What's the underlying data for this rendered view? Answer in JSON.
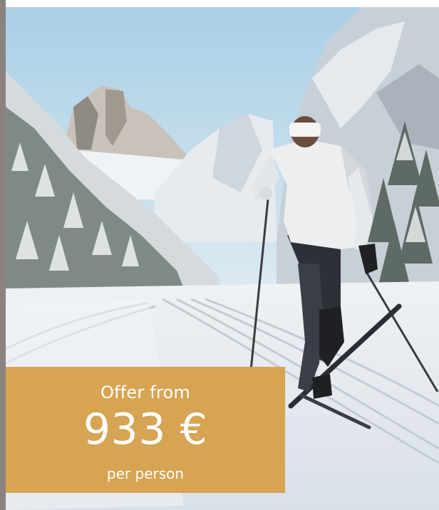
{
  "offer": {
    "label": "Offer from",
    "price": "933 €",
    "unit": "per person"
  },
  "colors": {
    "offer_background": "#d6a452",
    "offer_text": "#ffffff",
    "left_edge": "#8a827f"
  }
}
